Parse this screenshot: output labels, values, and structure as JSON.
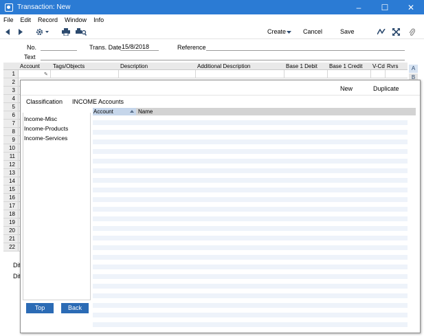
{
  "window": {
    "title": "Transaction: New",
    "controls": {
      "minimize": "–",
      "maximize": "☐",
      "close": "✕"
    }
  },
  "menubar": {
    "items": [
      "File",
      "Edit",
      "Record",
      "Window",
      "Info"
    ]
  },
  "toolbar": {
    "create_label": "Create",
    "cancel_label": "Cancel",
    "save_label": "Save",
    "icons": [
      "back-arrow-icon",
      "forward-arrow-icon",
      "gear-icon",
      "print-icon",
      "print-preview-icon",
      "graph-icon",
      "expand-icon",
      "attachment-icon"
    ]
  },
  "header": {
    "no_label": "No.",
    "no_value": "",
    "trans_date_label": "Trans. Date",
    "trans_date_value": "15/8/2018",
    "reference_label": "Reference",
    "reference_value": "",
    "text_label": "Text",
    "text_value": ""
  },
  "grid": {
    "columns": [
      "Account",
      "Tags/Objects",
      "Description",
      "Additional Description",
      "Base 1 Debit",
      "Base 1 Credit",
      "V-Cd",
      "Rvrs"
    ],
    "row_numbers": [
      "1",
      "2",
      "3",
      "4",
      "5",
      "6",
      "7",
      "8",
      "9",
      "10",
      "11",
      "12",
      "13",
      "14",
      "15",
      "16",
      "17",
      "18",
      "19",
      "20",
      "21",
      "22"
    ],
    "side_tabs": [
      "A",
      "B"
    ]
  },
  "footer": {
    "diff_label_1": "Dif",
    "diff_label_2": "Dif"
  },
  "overlay": {
    "new_label": "New",
    "duplicate_label": "Duplicate",
    "classification_label": "Classification",
    "classification_value": "INCOME Accounts",
    "list_items": [
      "Income-Misc",
      "Income-Products",
      "Income-Services"
    ],
    "columns": {
      "account": "Account",
      "name": "Name"
    },
    "top_label": "Top",
    "back_label": "Back"
  },
  "colors": {
    "titlebar": "#2b7bd4",
    "button": "#2b6bb5",
    "selected_header": "#c6d6ea",
    "stripe": "#eef3fa"
  }
}
